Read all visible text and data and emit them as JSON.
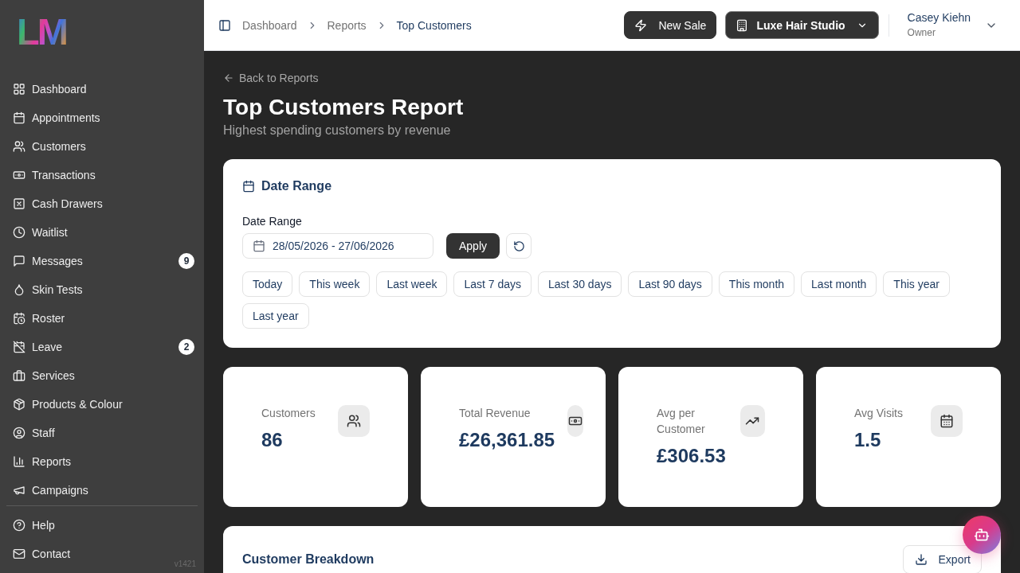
{
  "sidebar": {
    "logo": "LM",
    "nav_items": [
      {
        "label": "Dashboard"
      },
      {
        "label": "Appointments"
      },
      {
        "label": "Customers"
      },
      {
        "label": "Transactions"
      },
      {
        "label": "Cash Drawers"
      },
      {
        "label": "Waitlist"
      },
      {
        "label": "Messages",
        "badge": "9"
      },
      {
        "label": "Skin Tests"
      },
      {
        "label": "Roster"
      },
      {
        "label": "Leave",
        "badge": "2"
      },
      {
        "label": "Services"
      },
      {
        "label": "Products & Colour"
      },
      {
        "label": "Staff"
      },
      {
        "label": "Reports"
      },
      {
        "label": "Campaigns"
      }
    ],
    "footer_items": [
      {
        "label": "Help"
      },
      {
        "label": "Contact"
      }
    ],
    "version": "v1421"
  },
  "topbar": {
    "breadcrumb": [
      {
        "label": "Dashboard",
        "current": false
      },
      {
        "label": "Reports",
        "current": false
      },
      {
        "label": "Top Customers",
        "current": true
      }
    ],
    "new_sale_button": "New Sale",
    "location_selector": "Luxe Hair Studio",
    "user": {
      "name": "Casey Kiehn",
      "role": "Owner"
    }
  },
  "page": {
    "back_link": "Back to Reports",
    "title": "Top Customers Report",
    "subtitle": "Highest spending customers by revenue"
  },
  "date_range_card": {
    "title": "Date Range",
    "field_label": "Date Range",
    "field_value": "28/05/2026 - 27/06/2026",
    "apply_button": "Apply",
    "presets": [
      "Today",
      "This week",
      "Last week",
      "Last 7 days",
      "Last 30 days",
      "Last 90 days",
      "This month",
      "Last month",
      "This year",
      "Last year"
    ]
  },
  "stats": [
    {
      "label": "Customers",
      "value": "86"
    },
    {
      "label": "Total Revenue",
      "value": "£26,361.85"
    },
    {
      "label": "Avg per Customer",
      "value": "£306.53"
    },
    {
      "label": "Avg Visits",
      "value": "1.5"
    }
  ],
  "breakdown_card": {
    "title": "Customer Breakdown",
    "export_button": "Export"
  }
}
